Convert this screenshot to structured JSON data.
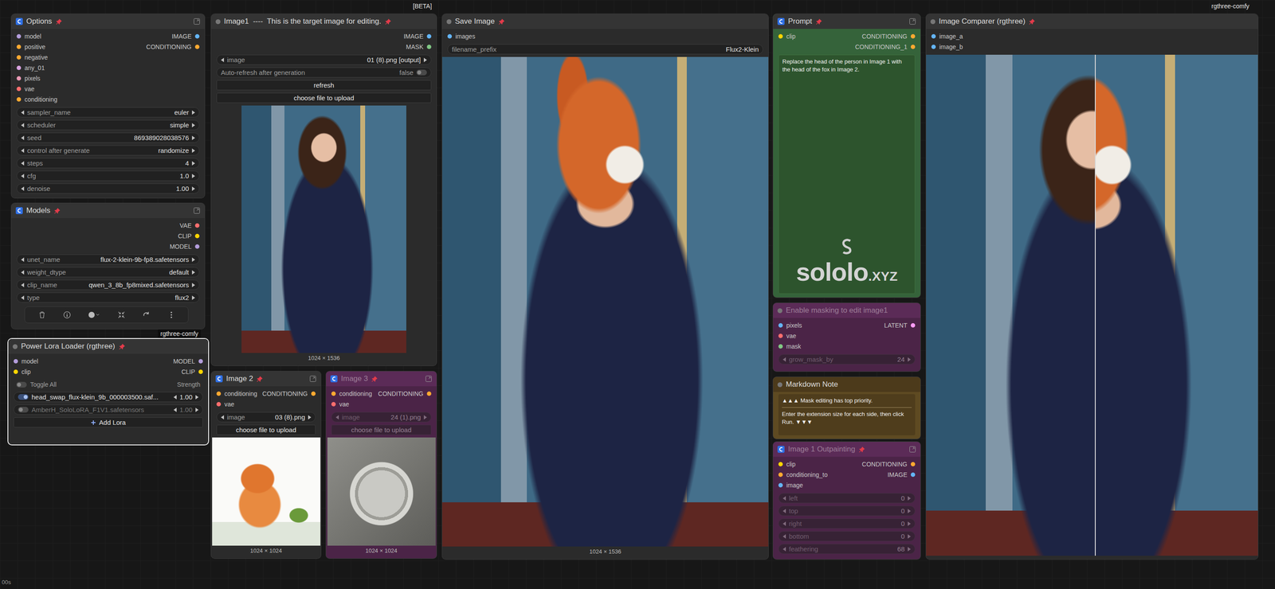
{
  "canvas": {
    "beta": "[BETA]",
    "brand": "rgthree-comfy",
    "timer": "00s",
    "tooltip": "rgthree-comfy"
  },
  "nodes": [
    {
      "title": "Options",
      "mode": "normal",
      "selected": false,
      "app_icon": true,
      "pinned": true,
      "slots": [
        {
          "in": {
            "label": "model",
            "color": "#b39ddb"
          },
          "out": {
            "label": "IMAGE",
            "color": "#64b5f6"
          }
        },
        {
          "in": {
            "label": "positive",
            "color": "#ffa931"
          },
          "out": {
            "label": "CONDITIONING",
            "color": "#ffa931"
          }
        },
        {
          "in": {
            "label": "negative",
            "color": "#ffa931"
          }
        },
        {
          "in": {
            "label": "any_01",
            "color": "#d9a3e0"
          }
        },
        {
          "in": {
            "label": "pixels",
            "color": "#ea9ab5"
          }
        },
        {
          "in": {
            "label": "vae",
            "color": "#ff6e6e"
          }
        },
        {
          "in": {
            "label": "conditioning",
            "color": "#ffa931"
          }
        }
      ],
      "widgets": [
        {
          "kind": "combo",
          "label": "sampler_name",
          "value": "euler"
        },
        {
          "kind": "combo",
          "label": "scheduler",
          "value": "simple"
        },
        {
          "kind": "combo",
          "label": "seed",
          "value": "869389028038576"
        },
        {
          "kind": "combo",
          "label": "control after generate",
          "value": "randomize"
        },
        {
          "kind": "combo",
          "label": "steps",
          "value": "4"
        },
        {
          "kind": "combo",
          "label": "cfg",
          "value": "1.0"
        },
        {
          "kind": "combo",
          "label": "denoise",
          "value": "1.00"
        }
      ]
    },
    {
      "title": "Models",
      "mode": "normal",
      "selected": false,
      "app_icon": true,
      "pinned": true,
      "slots": [
        {
          "out": {
            "label": "VAE",
            "color": "#ff6e6e"
          }
        },
        {
          "out": {
            "label": "CLIP",
            "color": "#ffd500"
          }
        },
        {
          "out": {
            "label": "MODEL",
            "color": "#b39ddb"
          }
        }
      ],
      "widgets": [
        {
          "kind": "combo",
          "label": "unet_name",
          "value": "flux-2-klein-9b-fp8.safetensors"
        },
        {
          "kind": "combo",
          "label": "weight_dtype",
          "value": "default"
        },
        {
          "kind": "combo",
          "label": "clip_name",
          "value": "qwen_3_8b_fp8mixed.safetensors"
        },
        {
          "kind": "combo",
          "label": "type",
          "value": "flux2"
        }
      ]
    },
    {
      "title": "Power Lora Loader (rgthree)",
      "mode": "normal",
      "selected": true,
      "app_icon": false,
      "pinned": true,
      "slots": [
        {
          "in": {
            "label": "model",
            "color": "#b39ddb"
          },
          "out": {
            "label": "MODEL",
            "color": "#b39ddb"
          }
        },
        {
          "in": {
            "label": "clip",
            "color": "#ffd500"
          },
          "out": {
            "label": "CLIP",
            "color": "#ffd500"
          }
        }
      ],
      "widgets": [
        {
          "kind": "lora_header",
          "label": "Toggle All",
          "strength_label": "Strength",
          "on": false
        },
        {
          "kind": "lora",
          "name": "head_swap_flux-klein_9b_000003500.saf...",
          "strength": "1.00",
          "on": true
        },
        {
          "kind": "lora",
          "name": "AmberH_SoloLoRA_F1V1.safetensors",
          "strength": "1.00",
          "on": false
        },
        {
          "kind": "add",
          "label": "Add Lora"
        }
      ]
    },
    {
      "title": "Image1  ----  This is the target image for editing.",
      "mode": "normal",
      "selected": false,
      "app_icon": false,
      "pinned": true,
      "slots": [
        {
          "out": {
            "label": "IMAGE",
            "color": "#64b5f6"
          }
        },
        {
          "out": {
            "label": "MASK",
            "color": "#81c784"
          }
        }
      ],
      "widgets": [
        {
          "kind": "combo",
          "label": "image",
          "value": "01 (8).png [output]"
        },
        {
          "kind": "toggle",
          "label": "Auto-refresh after generation",
          "value": "false",
          "on": false
        },
        {
          "kind": "button",
          "label": "refresh"
        },
        {
          "kind": "button",
          "label": "choose file to upload"
        },
        {
          "kind": "image",
          "photo": "woman",
          "caption": "1024 × 1536"
        }
      ]
    },
    {
      "title": "Image 2",
      "mode": "normal",
      "selected": false,
      "app_icon": true,
      "pinned": true,
      "slots": [
        {
          "in": {
            "label": "conditioning",
            "color": "#ffa931"
          },
          "out": {
            "label": "CONDITIONING",
            "color": "#ffa931"
          }
        },
        {
          "in": {
            "label": "vae",
            "color": "#ff6e6e"
          }
        }
      ],
      "widgets": [
        {
          "kind": "combo",
          "label": "image",
          "value": "03 (8).png"
        },
        {
          "kind": "button",
          "label": "choose file to upload"
        },
        {
          "kind": "image",
          "photo": "fox_drawing",
          "caption": "1024 × 1024"
        }
      ]
    },
    {
      "title": "Image 3",
      "mode": "bypass",
      "selected": false,
      "app_icon": true,
      "pinned": true,
      "slots": [
        {
          "in": {
            "label": "conditioning",
            "color": "#ffa931"
          },
          "out": {
            "label": "CONDITIONING",
            "color": "#ffa931"
          }
        },
        {
          "in": {
            "label": "vae",
            "color": "#ff6e6e"
          }
        }
      ],
      "widgets": [
        {
          "kind": "combo",
          "label": "image",
          "value": "24 (1).png"
        },
        {
          "kind": "button",
          "label": "choose file to upload"
        },
        {
          "kind": "image",
          "photo": "coin",
          "caption": "1024 × 1024"
        }
      ]
    },
    {
      "title": "Save Image",
      "mode": "normal",
      "selected": false,
      "app_icon": false,
      "pinned": true,
      "slots": [
        {
          "in": {
            "label": "images",
            "color": "#64b5f6"
          }
        }
      ],
      "widgets": [
        {
          "kind": "text",
          "label": "filename_prefix",
          "value": "Flux2-Klein"
        },
        {
          "kind": "image",
          "photo": "fox_edit",
          "caption": "1024 × 1536"
        }
      ]
    },
    {
      "title": "Prompt",
      "mode": "prompt",
      "selected": false,
      "app_icon": true,
      "pinned": true,
      "slots": [
        {
          "in": {
            "label": "clip",
            "color": "#ffd500"
          },
          "out": {
            "label": "CONDITIONING",
            "color": "#ffa931"
          }
        },
        {
          "out": {
            "label": "CONDITIONING_1",
            "color": "#ffa931"
          }
        }
      ],
      "widgets": [
        {
          "kind": "textarea",
          "text": "Replace the head of the person in Image 1 with the head of the fox in Image 2.",
          "watermark": "sololo",
          "watermark_suffix": ".XYZ"
        }
      ]
    },
    {
      "title": "Enable masking to edit image1",
      "mode": "bypass",
      "selected": false,
      "app_icon": false,
      "pinned": false,
      "slots": [
        {
          "in": {
            "label": "pixels",
            "color": "#64b5f6"
          },
          "out": {
            "label": "LATENT",
            "color": "#ff9cf9"
          }
        },
        {
          "in": {
            "label": "vae",
            "color": "#ff6e6e"
          }
        },
        {
          "in": {
            "label": "mask",
            "color": "#81c784"
          }
        }
      ],
      "widgets": [
        {
          "kind": "combo",
          "label": "grow_mask_by",
          "value": "24"
        }
      ]
    },
    {
      "title": "Markdown Note",
      "mode": "note",
      "selected": false,
      "app_icon": false,
      "pinned": false,
      "slots": [],
      "widgets": [
        {
          "kind": "markdown",
          "lines": [
            "▲▲▲ Mask editing has top priority.",
            "Enter the extension size for each side, then click Run. ▼▼▼"
          ]
        }
      ]
    },
    {
      "title": "Image 1 Outpainting",
      "mode": "bypass",
      "selected": false,
      "app_icon": true,
      "pinned": true,
      "slots": [
        {
          "in": {
            "label": "clip",
            "color": "#ffd500"
          },
          "out": {
            "label": "CONDITIONING",
            "color": "#ffa931"
          }
        },
        {
          "in": {
            "label": "conditioning_to",
            "color": "#ffa931"
          },
          "out": {
            "label": "IMAGE",
            "color": "#64b5f6"
          }
        },
        {
          "in": {
            "label": "image",
            "color": "#64b5f6"
          }
        }
      ],
      "widgets": [
        {
          "kind": "combo",
          "label": "left",
          "value": "0"
        },
        {
          "kind": "combo",
          "label": "top",
          "value": "0"
        },
        {
          "kind": "combo",
          "label": "right",
          "value": "0"
        },
        {
          "kind": "combo",
          "label": "bottom",
          "value": "0"
        },
        {
          "kind": "combo",
          "label": "feathering",
          "value": "68"
        }
      ]
    },
    {
      "title": "Image Comparer (rgthree)",
      "mode": "normal",
      "selected": false,
      "app_icon": false,
      "pinned": true,
      "slots": [
        {
          "in": {
            "label": "image_a",
            "color": "#64b5f6"
          }
        },
        {
          "in": {
            "label": "image_b",
            "color": "#64b5f6"
          }
        }
      ],
      "widgets": [
        {
          "kind": "comparer",
          "level": 0.51
        }
      ]
    }
  ]
}
